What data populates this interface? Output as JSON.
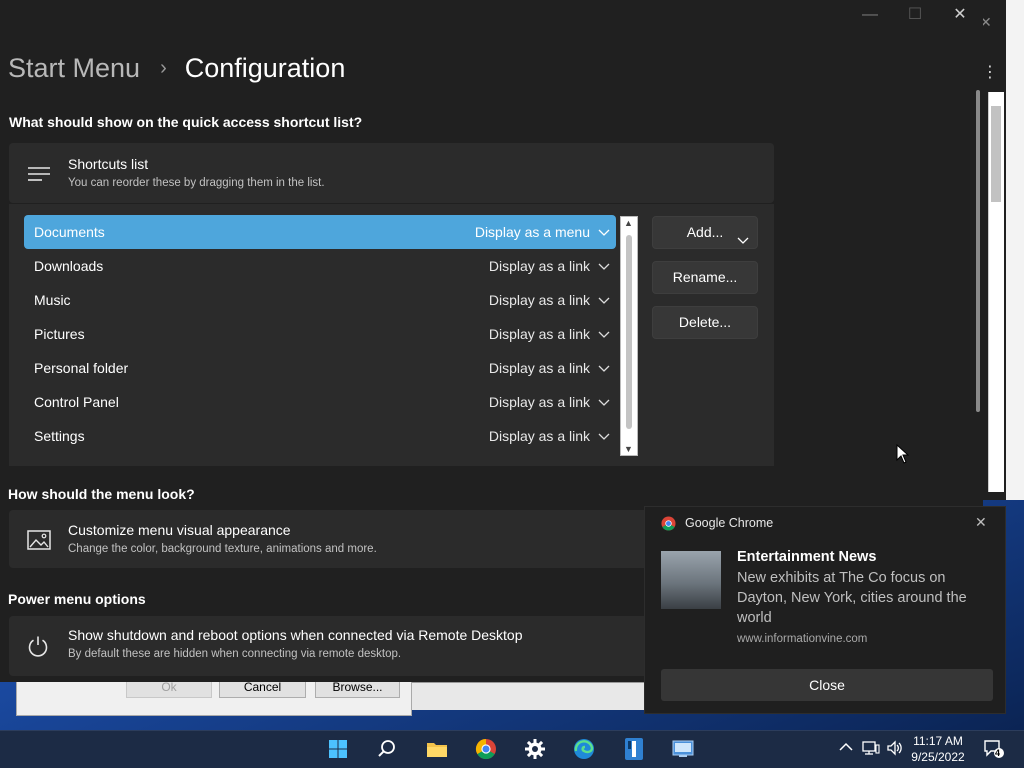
{
  "breadcrumb": {
    "root": "Start Menu",
    "separator": "›",
    "current": "Configuration"
  },
  "window_controls": {
    "minimize": "—",
    "maximize": "☐",
    "close": "✕"
  },
  "shortcut_section": {
    "heading": "What should show on the quick access shortcut list?",
    "card_title": "Shortcuts list",
    "card_subtitle": "You can reorder these by dragging them in the list.",
    "items": [
      {
        "name": "Documents",
        "mode": "Display as a menu",
        "selected": true
      },
      {
        "name": "Downloads",
        "mode": "Display as a link"
      },
      {
        "name": "Music",
        "mode": "Display as a link"
      },
      {
        "name": "Pictures",
        "mode": "Display as a link"
      },
      {
        "name": "Personal folder",
        "mode": "Display as a link"
      },
      {
        "name": "Control Panel",
        "mode": "Display as a link"
      },
      {
        "name": "Settings",
        "mode": "Display as a link"
      }
    ],
    "buttons": {
      "add": "Add...",
      "rename": "Rename...",
      "delete": "Delete..."
    }
  },
  "look_section": {
    "heading": "How should the menu look?",
    "card_title": "Customize menu visual appearance",
    "card_subtitle": "Change the color, background texture, animations and more."
  },
  "power_section": {
    "heading": "Power menu options",
    "card_title": "Show shutdown and reboot options when connected via Remote Desktop",
    "card_subtitle": "By default these are hidden when connecting via remote desktop."
  },
  "background_dialog": {
    "ok": "Ok",
    "cancel": "Cancel",
    "browse": "Browse..."
  },
  "notification": {
    "app": "Google Chrome",
    "title": "Entertainment News",
    "body": "New exhibits at The Co focus on Dayton, New York, cities around the world",
    "source": "www.informationvine.com",
    "close_button": "Close"
  },
  "taskbar": {
    "time": "11:17 AM",
    "date": "9/25/2022",
    "notification_count": "4",
    "icons": [
      "windows-start-icon",
      "search-icon",
      "file-explorer-icon",
      "chrome-icon",
      "settings-gear-icon",
      "edge-icon",
      "app-icon",
      "remote-desktop-icon"
    ]
  },
  "colors": {
    "accent_selection": "#4ea6dc",
    "window_bg": "#202020",
    "card_bg": "#2b2b2b"
  }
}
